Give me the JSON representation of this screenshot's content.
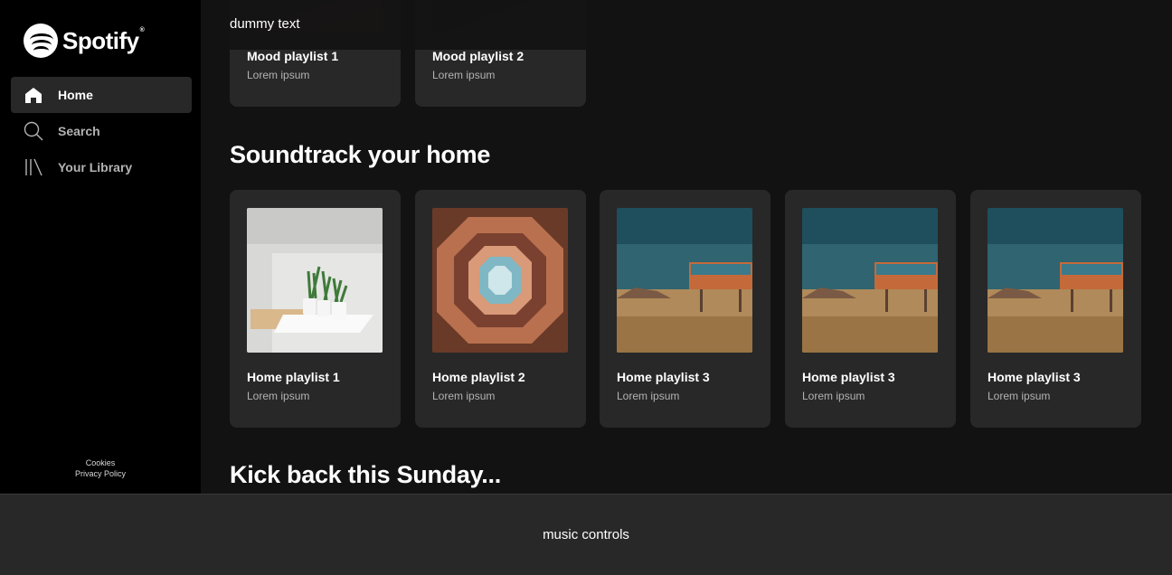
{
  "brand": {
    "name": "Spotify",
    "reg": "®"
  },
  "nav": {
    "items": [
      {
        "label": "Home",
        "icon": "home-icon",
        "active": true
      },
      {
        "label": "Search",
        "icon": "search-icon",
        "active": false
      },
      {
        "label": "Your Library",
        "icon": "library-icon",
        "active": false
      }
    ]
  },
  "legal": {
    "cookies": "Cookies",
    "privacy": "Privacy Policy"
  },
  "topbar": {
    "text": "dummy text"
  },
  "sections": {
    "mood": {
      "cards": [
        {
          "title": "Mood playlist 1",
          "subtitle": "Lorem ipsum"
        },
        {
          "title": "Mood playlist 2",
          "subtitle": "Lorem ipsum"
        }
      ]
    },
    "home": {
      "title": "Soundtrack your home",
      "cards": [
        {
          "title": "Home playlist 1",
          "subtitle": "Lorem ipsum"
        },
        {
          "title": "Home playlist 2",
          "subtitle": "Lorem ipsum"
        },
        {
          "title": "Home playlist 3",
          "subtitle": "Lorem ipsum"
        },
        {
          "title": "Home playlist 3",
          "subtitle": "Lorem ipsum"
        },
        {
          "title": "Home playlist 3",
          "subtitle": "Lorem ipsum"
        }
      ]
    },
    "sunday": {
      "title": "Kick back this Sunday..."
    }
  },
  "player": {
    "text": "music controls"
  },
  "colors": {
    "sidebar": "#000000",
    "main": "#121212",
    "card": "#282828",
    "muted": "#b3b3b3"
  }
}
